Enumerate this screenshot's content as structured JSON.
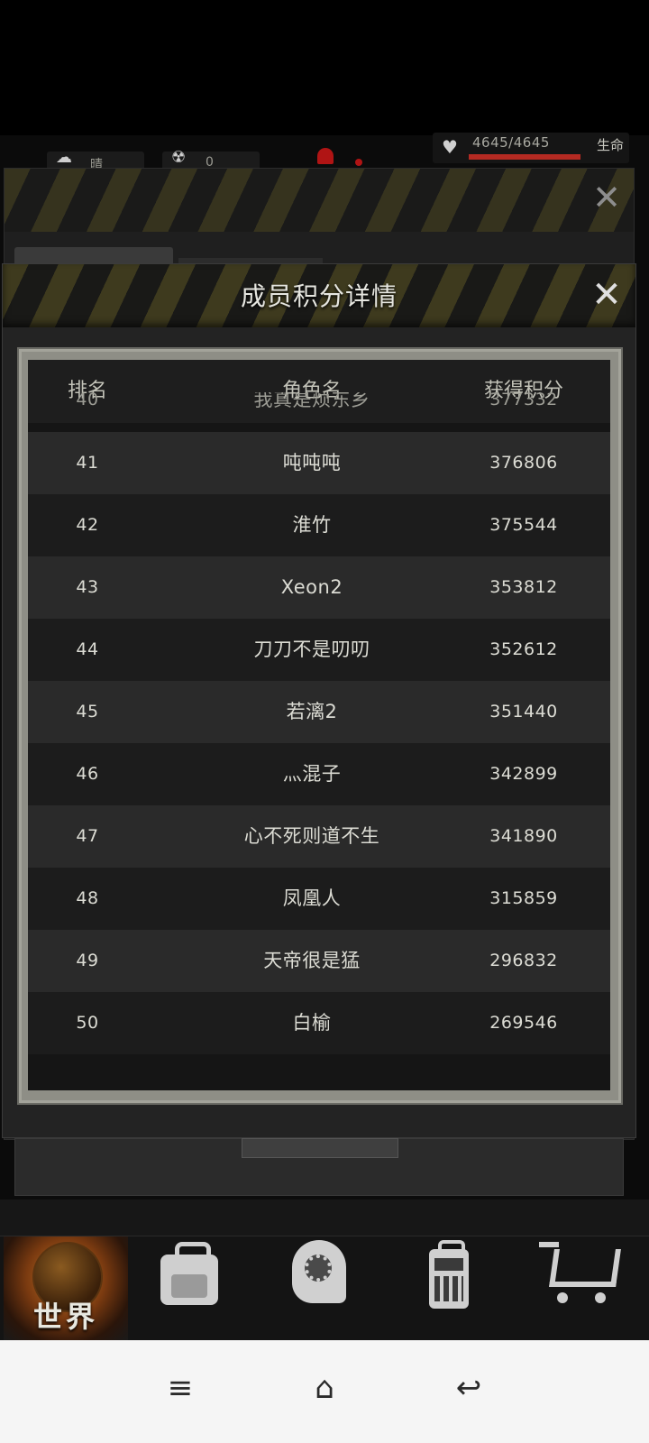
{
  "hud": {
    "weather_icon": "cloud-sun-icon",
    "weather_text": "晴",
    "radiation_icon": "radiation-icon",
    "radiation_value": "0",
    "hp_text": "4645/4645",
    "hp_fraction": 1.0,
    "hp_label": "生命",
    "hp_color": "#b42a22"
  },
  "modal": {
    "title": "成员积分详情",
    "close_glyph": "✕",
    "columns": [
      "排名",
      "角色名",
      "获得积分"
    ],
    "partial_row": {
      "rank": "40",
      "name": "我真是烦东乡",
      "score": "377332"
    },
    "rows": [
      {
        "rank": "41",
        "name": "吨吨吨",
        "score": "376806"
      },
      {
        "rank": "42",
        "name": "淮竹",
        "score": "375544"
      },
      {
        "rank": "43",
        "name": "Xeon2",
        "score": "353812"
      },
      {
        "rank": "44",
        "name": "刀刀不是叨叨",
        "score": "352612"
      },
      {
        "rank": "45",
        "name": "若漓2",
        "score": "351440"
      },
      {
        "rank": "46",
        "name": "灬混子",
        "score": "342899"
      },
      {
        "rank": "47",
        "name": "心不死则道不生",
        "score": "341890"
      },
      {
        "rank": "48",
        "name": "凤凰人",
        "score": "315859"
      },
      {
        "rank": "49",
        "name": "天帝很是猛",
        "score": "296832"
      },
      {
        "rank": "50",
        "name": "白榆",
        "score": "269546"
      }
    ]
  },
  "nav": {
    "world_label": "世界",
    "items": [
      "world-icon",
      "backpack-icon",
      "skills-head-icon",
      "radio-icon",
      "shop-cart-icon"
    ]
  },
  "system_bar": {
    "menu_glyph": "≡",
    "home_glyph": "⌂",
    "back_glyph": "↩"
  }
}
